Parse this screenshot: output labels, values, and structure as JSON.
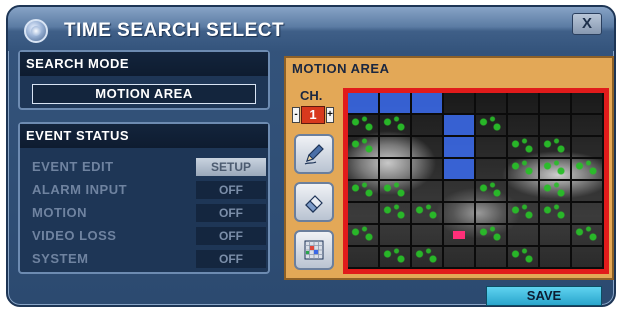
{
  "window": {
    "title": "TIME SEARCH SELECT",
    "close_label": "X"
  },
  "search_mode": {
    "header": "SEARCH MODE",
    "value": "MOTION AREA"
  },
  "event_status": {
    "header": "EVENT STATUS",
    "rows": [
      {
        "label": "EVENT EDIT",
        "value": "SETUP"
      },
      {
        "label": "ALARM INPUT",
        "value": "OFF"
      },
      {
        "label": "MOTION",
        "value": "OFF"
      },
      {
        "label": "VIDEO LOSS",
        "value": "OFF"
      },
      {
        "label": "SYSTEM",
        "value": "OFF"
      }
    ]
  },
  "motion_area": {
    "header": "MOTION AREA",
    "channel_label": "CH.",
    "channel_value": "1",
    "minus_label": "-",
    "plus_label": "+",
    "tools": [
      "pen-icon",
      "eraser-icon",
      "grid-select-icon"
    ],
    "grid": {
      "rows": 8,
      "cols": 8,
      "selected_cells": [
        [
          0,
          0
        ],
        [
          0,
          1
        ],
        [
          0,
          2
        ],
        [
          1,
          3
        ],
        [
          2,
          3
        ],
        [
          3,
          3
        ]
      ],
      "motion_cells": [
        [
          1,
          0
        ],
        [
          1,
          1
        ],
        [
          1,
          4
        ],
        [
          2,
          0
        ],
        [
          2,
          5
        ],
        [
          2,
          6
        ],
        [
          3,
          5
        ],
        [
          3,
          6
        ],
        [
          3,
          7
        ],
        [
          4,
          0
        ],
        [
          4,
          1
        ],
        [
          4,
          4
        ],
        [
          4,
          6
        ],
        [
          5,
          1
        ],
        [
          5,
          2
        ],
        [
          5,
          5
        ],
        [
          5,
          6
        ],
        [
          6,
          0
        ],
        [
          6,
          4
        ],
        [
          6,
          7
        ],
        [
          7,
          1
        ],
        [
          7,
          2
        ],
        [
          7,
          5
        ]
      ],
      "alert_cells": [
        [
          6,
          3
        ]
      ]
    },
    "colors": {
      "frame": "#e11b1b",
      "selected": "#3a68e6",
      "motion": "#28be28",
      "alert": "#ff2f79",
      "panel": "#e3a857"
    }
  },
  "footer": {
    "save_label": "SAVE"
  }
}
